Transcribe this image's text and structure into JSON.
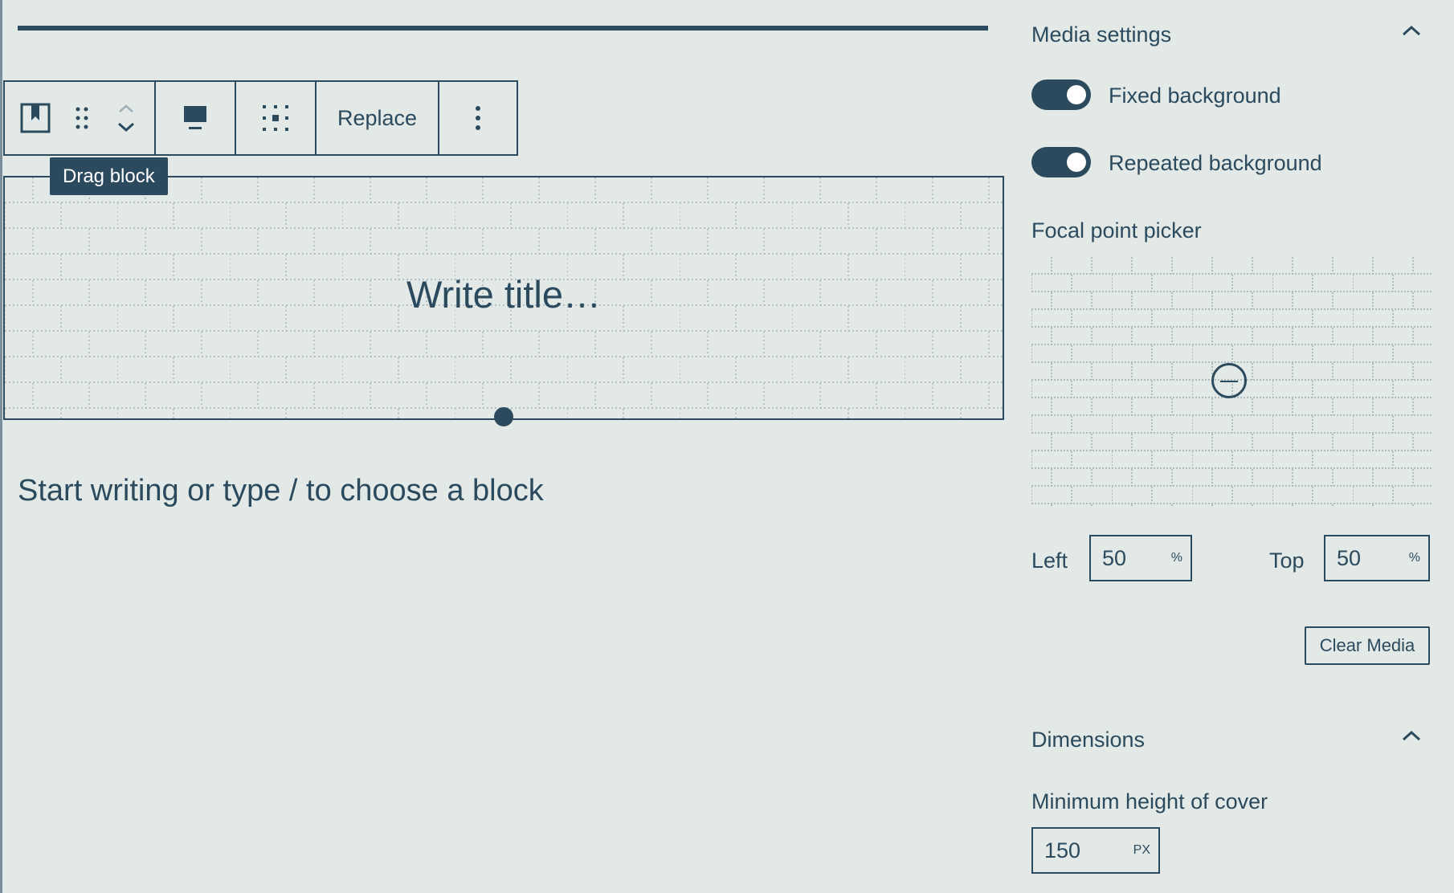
{
  "toolbar": {
    "block_icon": "cover-block-icon",
    "drag_icon": "drag-handle-icon",
    "move_icons": [
      "chevron-up-icon",
      "chevron-down-icon"
    ],
    "align_icon": "align-full-icon",
    "position_icon": "content-position-icon",
    "replace_label": "Replace",
    "more_icon": "more-options-icon"
  },
  "tooltip": {
    "text": "Drag block"
  },
  "cover": {
    "title_placeholder": "Write title…"
  },
  "editor": {
    "appender_placeholder": "Start writing or type / to choose a block"
  },
  "sidebar": {
    "media_settings": {
      "title": "Media settings",
      "toggles": [
        {
          "label": "Fixed background",
          "on": true
        },
        {
          "label": "Repeated background",
          "on": true
        }
      ],
      "focal_picker_label": "Focal point picker",
      "left_label": "Left",
      "left_value": "50",
      "left_unit": "%",
      "top_label": "Top",
      "top_value": "50",
      "top_unit": "%",
      "clear_button": "Clear Media"
    },
    "dimensions": {
      "title": "Dimensions",
      "min_height_label": "Minimum height of cover",
      "min_height_value": "150",
      "min_height_unit": "PX"
    }
  },
  "colors": {
    "ink": "#2c4a5e",
    "background": "#e2e9e6"
  }
}
